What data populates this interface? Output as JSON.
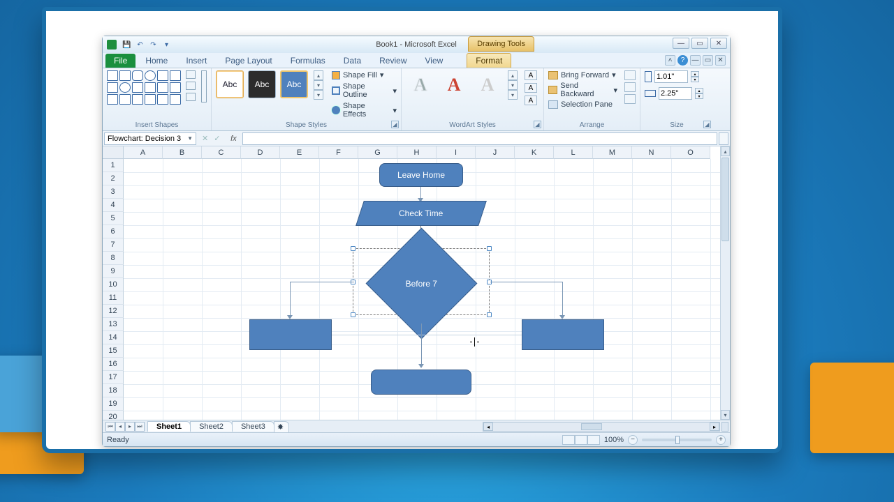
{
  "title": "Book1 - Microsoft Excel",
  "context_tab": "Drawing Tools",
  "tabs": {
    "file": "File",
    "home": "Home",
    "insert": "Insert",
    "page_layout": "Page Layout",
    "formulas": "Formulas",
    "data": "Data",
    "review": "Review",
    "view": "View",
    "format": "Format"
  },
  "ribbon": {
    "insert_shapes": "Insert Shapes",
    "shape_styles": "Shape Styles",
    "swatch_label": "Abc",
    "shape_fill": "Shape Fill",
    "shape_outline": "Shape Outline",
    "shape_effects": "Shape Effects",
    "wordart_styles": "WordArt Styles",
    "wa_glyph": "A",
    "arrange": "Arrange",
    "bring_forward": "Bring Forward",
    "send_backward": "Send Backward",
    "selection_pane": "Selection Pane",
    "size": "Size",
    "height": "1.01\"",
    "width": "2.25\""
  },
  "namebox": "Flowchart: Decision 3",
  "columns": [
    "A",
    "B",
    "C",
    "D",
    "E",
    "F",
    "G",
    "H",
    "I",
    "J",
    "K",
    "L",
    "M",
    "N",
    "O"
  ],
  "rows": [
    "1",
    "2",
    "3",
    "4",
    "5",
    "6",
    "7",
    "8",
    "9",
    "10",
    "11",
    "12",
    "13",
    "14",
    "15",
    "16",
    "17",
    "18",
    "19",
    "20"
  ],
  "flow": {
    "leave_home": "Leave Home",
    "check_time": "Check Time",
    "before7": "Before 7"
  },
  "sheets": {
    "s1": "Sheet1",
    "s2": "Sheet2",
    "s3": "Sheet3"
  },
  "status": {
    "ready": "Ready",
    "zoom": "100%"
  }
}
